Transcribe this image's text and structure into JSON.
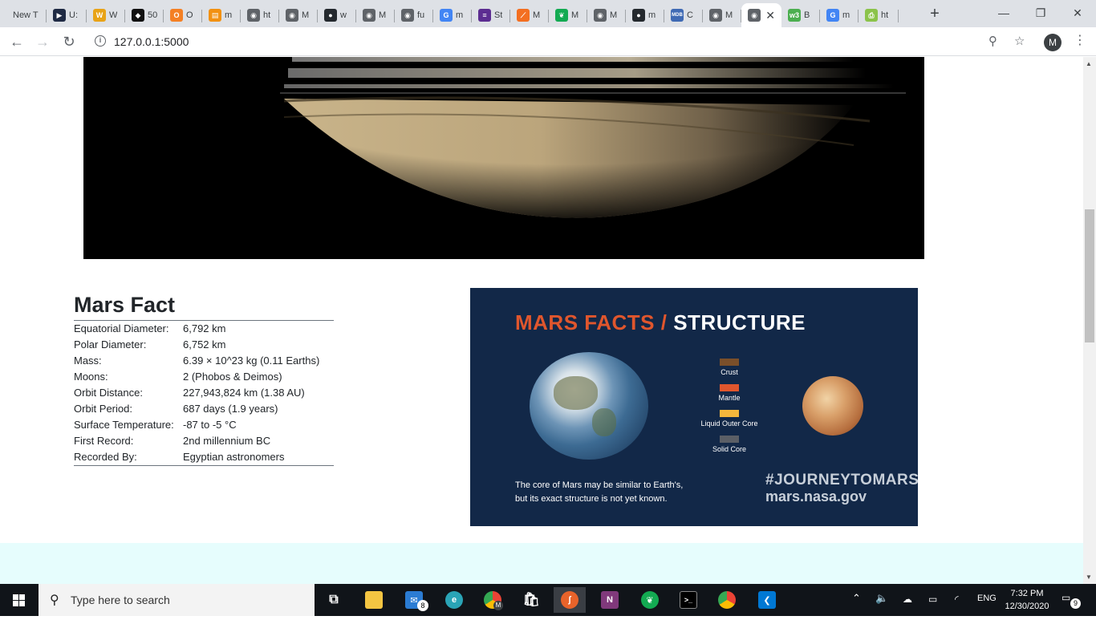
{
  "browser": {
    "tabs": [
      {
        "label": "New T",
        "fav_color": "#dee1e6",
        "fav_glyph": ""
      },
      {
        "label": "U:",
        "fav_color": "#1f2a44",
        "fav_glyph": "▶"
      },
      {
        "label": "W",
        "fav_color": "#e8a317",
        "fav_glyph": "W"
      },
      {
        "label": "50",
        "fav_color": "#111111",
        "fav_glyph": "◆"
      },
      {
        "label": "O",
        "fav_color": "#f48024",
        "fav_glyph": "O"
      },
      {
        "label": "m",
        "fav_color": "#f29111",
        "fav_glyph": "▤"
      },
      {
        "label": "ht",
        "fav_color": "#5f6368",
        "fav_glyph": "◉"
      },
      {
        "label": "M",
        "fav_color": "#5f6368",
        "fav_glyph": "◉"
      },
      {
        "label": "w",
        "fav_color": "#24292e",
        "fav_glyph": "●"
      },
      {
        "label": "M",
        "fav_color": "#5f6368",
        "fav_glyph": "◉"
      },
      {
        "label": "fu",
        "fav_color": "#5f6368",
        "fav_glyph": "◉"
      },
      {
        "label": "m",
        "fav_color": "#4285f4",
        "fav_glyph": "G"
      },
      {
        "label": "St",
        "fav_color": "#5c2d91",
        "fav_glyph": "≡"
      },
      {
        "label": "M",
        "fav_color": "#f36f21",
        "fav_glyph": "⟋"
      },
      {
        "label": "M",
        "fav_color": "#13aa52",
        "fav_glyph": "❦"
      },
      {
        "label": "M",
        "fav_color": "#5f6368",
        "fav_glyph": "◉"
      },
      {
        "label": "m",
        "fav_color": "#24292e",
        "fav_glyph": "●"
      },
      {
        "label": "C",
        "fav_color": "#3f6ab4",
        "fav_glyph": "MDB"
      },
      {
        "label": "M",
        "fav_color": "#5f6368",
        "fav_glyph": "◉"
      },
      {
        "label": "",
        "fav_color": "#5f6368",
        "fav_glyph": "◉",
        "active": true
      },
      {
        "label": "B",
        "fav_color": "#4caf50",
        "fav_glyph": "w3"
      },
      {
        "label": "m",
        "fav_color": "#4285f4",
        "fav_glyph": "G"
      },
      {
        "label": "ht",
        "fav_color": "#8bc34a",
        "fav_glyph": "⎙"
      }
    ],
    "url": "127.0.0.1:5000",
    "profile_initial": "M"
  },
  "facts": {
    "title": "Mars Fact",
    "rows": [
      {
        "label": "Equatorial Diameter:",
        "value": "6,792 km"
      },
      {
        "label": "Polar Diameter:",
        "value": "6,752 km"
      },
      {
        "label": "Mass:",
        "value": "6.39 × 10^23 kg (0.11 Earths)"
      },
      {
        "label": "Moons:",
        "value": "2 (Phobos & Deimos)"
      },
      {
        "label": "Orbit Distance:",
        "value": "227,943,824 km (1.38 AU)"
      },
      {
        "label": "Orbit Period:",
        "value": "687 days (1.9 years)"
      },
      {
        "label": "Surface Temperature:",
        "value": "-87 to -5 °C"
      },
      {
        "label": "First Record:",
        "value": "2nd millennium BC"
      },
      {
        "label": "Recorded By:",
        "value": "Egyptian astronomers"
      }
    ]
  },
  "poster": {
    "title_a": "MARS FACTS /",
    "title_b": "STRUCTURE",
    "legend": [
      {
        "label": "Crust",
        "color": "#7a4f2a"
      },
      {
        "label": "Mantle",
        "color": "#e0562d"
      },
      {
        "label": "Liquid Outer Core",
        "color": "#f4b73c"
      },
      {
        "label": "Solid Core",
        "color": "#5b5f66"
      }
    ],
    "caption_line1": "The core of Mars may be similar to Earth's,",
    "caption_line2": "but its exact structure is not yet known.",
    "hashtag": "#JOURNEYTOMARS",
    "site": "mars.nasa.gov"
  },
  "taskbar": {
    "search_placeholder": "Type here to search",
    "mail_badge": "8",
    "chrome_badge": "M",
    "lang": "ENG",
    "time": "7:32 PM",
    "date": "12/30/2020",
    "notifications": "9"
  }
}
